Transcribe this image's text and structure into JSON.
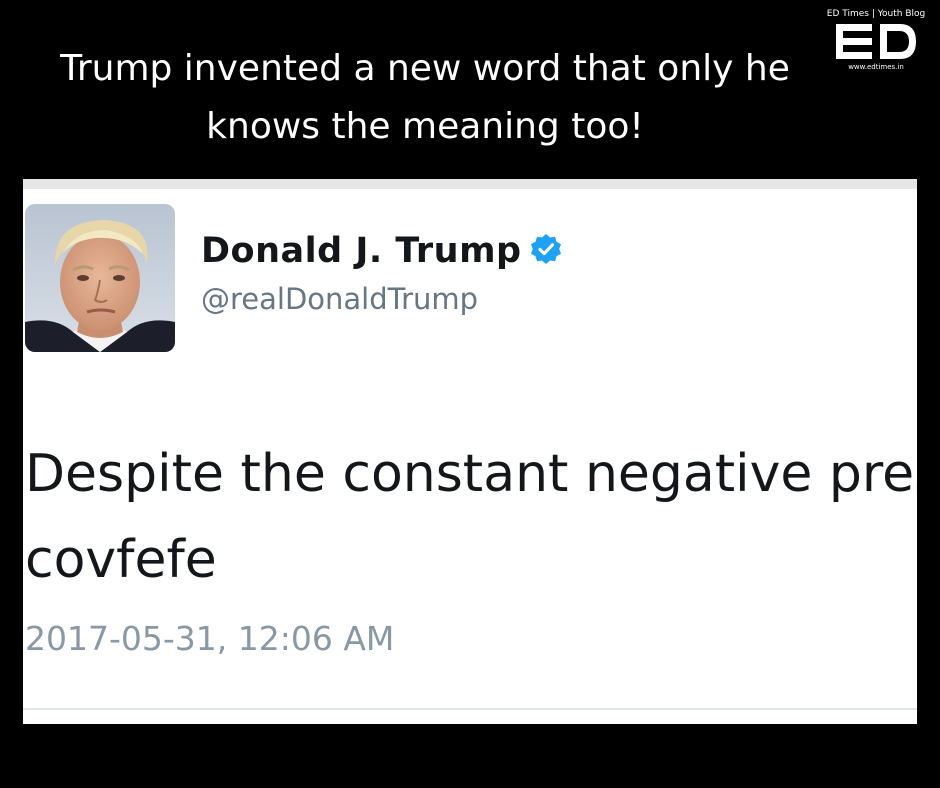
{
  "headline": {
    "line1": "Trump invented a new word that only he",
    "line2": "knows the meaning too!"
  },
  "logo": {
    "top_text": "ED Times | Youth Blog",
    "mark": "ED",
    "url_text": "www.edtimes.in"
  },
  "tweet": {
    "display_name": "Donald J. Trump",
    "handle": "@realDonaldTrump",
    "verified_icon": "verified-badge-icon",
    "line1": "Despite the constant negative pres",
    "line2": "covfefe",
    "timestamp": "2017-05-31, 12:06 AM"
  },
  "colors": {
    "background": "#000000",
    "card": "#ffffff",
    "verified": "#1da1f2",
    "secondary_text": "#657786",
    "timestamp_text": "#8899a6"
  }
}
